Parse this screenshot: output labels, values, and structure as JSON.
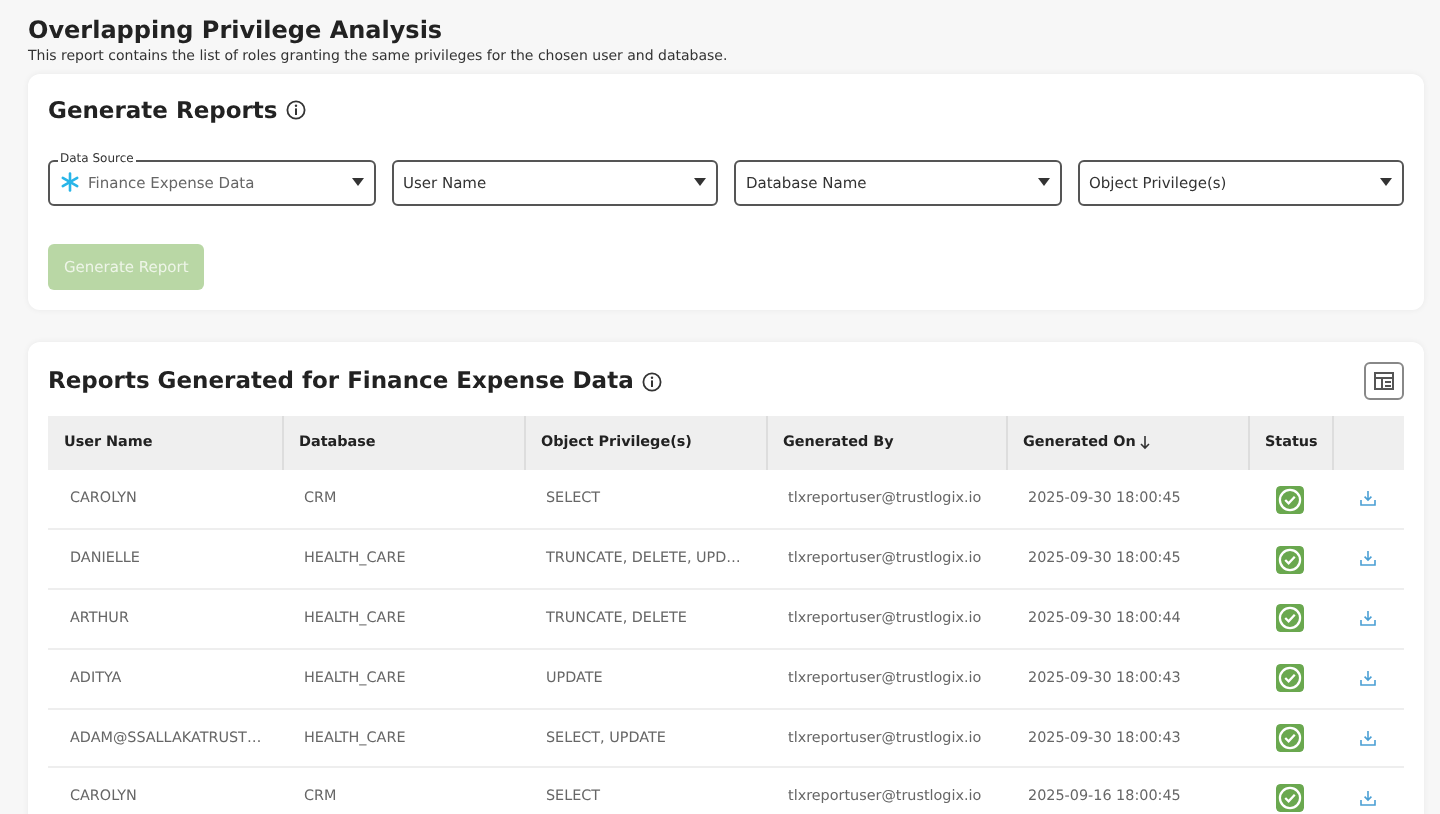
{
  "page": {
    "title": "Overlapping Privilege Analysis",
    "subtitle": "This report contains the list of roles granting the same privileges for the chosen user and database."
  },
  "generate": {
    "title": "Generate Reports",
    "fields": [
      {
        "label": "Data Source",
        "value": "Finance Expense Data",
        "kind": "source"
      },
      {
        "placeholder": "User Name",
        "kind": "plain"
      },
      {
        "placeholder": "Database Name",
        "kind": "plain"
      },
      {
        "placeholder": "Object Privilege(s)",
        "kind": "plain"
      }
    ],
    "button": {
      "label": "Generate Report",
      "disabled": true
    }
  },
  "reports": {
    "title": "Reports Generated for Finance Expense Data",
    "columns": [
      {
        "label": "User Name",
        "sorted": false
      },
      {
        "label": "Database",
        "sorted": false
      },
      {
        "label": "Object Privilege(s)",
        "sorted": false
      },
      {
        "label": "Generated By",
        "sorted": false
      },
      {
        "label": "Generated On",
        "sorted": true
      },
      {
        "label": "Status",
        "sorted": false
      }
    ],
    "rows": [
      {
        "user": "CAROLYN",
        "database": "CRM",
        "privileges": "SELECT",
        "by": "tlxreportuser@trustlogix.io",
        "on": "2025-09-30 18:00:45",
        "succeeded": true
      },
      {
        "user": "DANIELLE",
        "database": "HEALTH_CARE",
        "privileges": "TRUNCATE, DELETE, UPD…",
        "by": "tlxreportuser@trustlogix.io",
        "on": "2025-09-30 18:00:45",
        "succeeded": true
      },
      {
        "user": "ARTHUR",
        "database": "HEALTH_CARE",
        "privileges": "TRUNCATE, DELETE",
        "by": "tlxreportuser@trustlogix.io",
        "on": "2025-09-30 18:00:44",
        "succeeded": true
      },
      {
        "user": "ADITYA",
        "database": "HEALTH_CARE",
        "privileges": "UPDATE",
        "by": "tlxreportuser@trustlogix.io",
        "on": "2025-09-30 18:00:43",
        "succeeded": true
      },
      {
        "user": "ADAM@SSALLAKATRUST…",
        "database": "HEALTH_CARE",
        "privileges": "SELECT, UPDATE",
        "by": "tlxreportuser@trustlogix.io",
        "on": "2025-09-30 18:00:43",
        "succeeded": true
      },
      {
        "user": "CAROLYN",
        "database": "CRM",
        "privileges": "SELECT",
        "by": "tlxreportuser@trustlogix.io",
        "on": "2025-09-16 18:00:45",
        "succeeded": true
      }
    ]
  }
}
